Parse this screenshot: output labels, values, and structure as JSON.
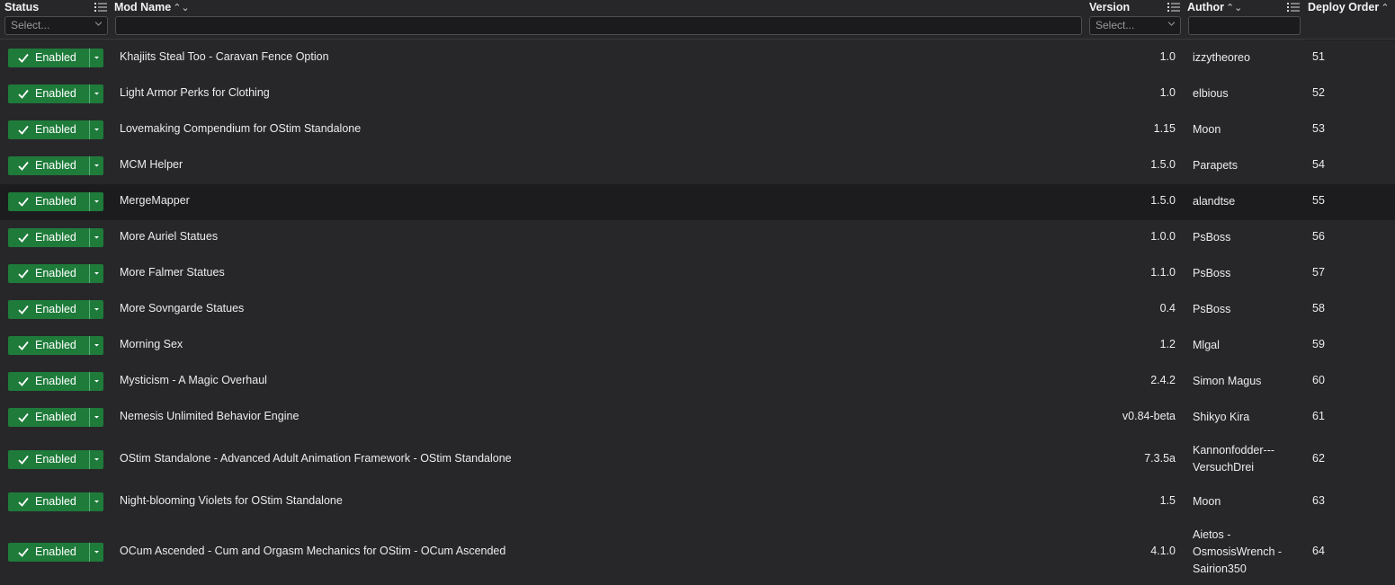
{
  "header": {
    "status_title": "Status",
    "modname_title": "Mod Name",
    "version_title": "Version",
    "author_title": "Author",
    "deploy_title": "Deploy Order",
    "status_filter_placeholder": "Select...",
    "version_filter_placeholder": "Select...",
    "modname_filter_value": "",
    "author_filter_value": "",
    "column_icon": "list-filter-icon",
    "sort_icon_modname": "sort-both-icon",
    "sort_icon_author": "sort-both-icon",
    "sort_icon_deploy": "sort-ascending-icon"
  },
  "colors": {
    "enabled_green": "#1e7b3a",
    "background": "#27272a",
    "highlight_row": "#1c1c1e"
  },
  "rows": [
    {
      "status": "Enabled",
      "name": "Khajiits Steal Too - Caravan Fence Option",
      "version": "1.0",
      "author": [
        "izzytheoreo"
      ],
      "order": "51"
    },
    {
      "status": "Enabled",
      "name": "Light Armor Perks for Clothing",
      "version": "1.0",
      "author": [
        "elbious"
      ],
      "order": "52"
    },
    {
      "status": "Enabled",
      "name": "Lovemaking Compendium for OStim Standalone",
      "version": "1.15",
      "author": [
        "Moon"
      ],
      "order": "53"
    },
    {
      "status": "Enabled",
      "name": "MCM Helper",
      "version": "1.5.0",
      "author": [
        "Parapets"
      ],
      "order": "54"
    },
    {
      "status": "Enabled",
      "name": "MergeMapper",
      "version": "1.5.0",
      "author": [
        "alandtse"
      ],
      "order": "55"
    },
    {
      "status": "Enabled",
      "name": "More Auriel Statues",
      "version": "1.0.0",
      "author": [
        "PsBoss"
      ],
      "order": "56"
    },
    {
      "status": "Enabled",
      "name": "More Falmer Statues",
      "version": "1.1.0",
      "author": [
        "PsBoss"
      ],
      "order": "57"
    },
    {
      "status": "Enabled",
      "name": "More Sovngarde Statues",
      "version": "0.4",
      "author": [
        "PsBoss"
      ],
      "order": "58"
    },
    {
      "status": "Enabled",
      "name": "Morning Sex",
      "version": "1.2",
      "author": [
        "Mlgal"
      ],
      "order": "59"
    },
    {
      "status": "Enabled",
      "name": "Mysticism - A Magic Overhaul",
      "version": "2.4.2",
      "author": [
        "Simon Magus"
      ],
      "order": "60"
    },
    {
      "status": "Enabled",
      "name": "Nemesis Unlimited Behavior Engine",
      "version": "v0.84-beta",
      "author": [
        "Shikyo Kira"
      ],
      "order": "61"
    },
    {
      "status": "Enabled",
      "name": "OStim Standalone - Advanced Adult Animation Framework - OStim Standalone",
      "version": "7.3.5a",
      "author": [
        "Kannonfodder---",
        "VersuchDrei"
      ],
      "order": "62"
    },
    {
      "status": "Enabled",
      "name": "Night-blooming Violets for OStim Standalone",
      "version": "1.5",
      "author": [
        "Moon"
      ],
      "order": "63"
    },
    {
      "status": "Enabled",
      "name": "OCum Ascended - Cum and Orgasm Mechanics for OStim - OCum Ascended",
      "version": "4.1.0",
      "author": [
        "Aietos -",
        "OsmosisWrench -",
        "Sairion350"
      ],
      "order": "64"
    }
  ]
}
